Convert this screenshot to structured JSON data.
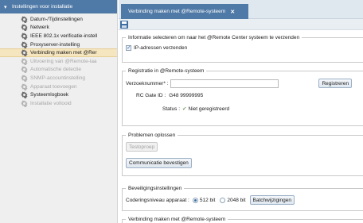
{
  "nav": {
    "header": "Instellingen voor installatie",
    "items": [
      {
        "label": "Datum-/Tijdinstellingen",
        "state": "normal"
      },
      {
        "label": "Netwerk",
        "state": "normal"
      },
      {
        "label": "IEEE 802.1x verificatie-instell",
        "state": "normal"
      },
      {
        "label": "Proxyserver-instelling",
        "state": "normal"
      },
      {
        "label": "Verbinding maken met @Rer",
        "state": "active"
      },
      {
        "label": "Uitvoering van @Remote-laa",
        "state": "disabled"
      },
      {
        "label": "Automatische detectie",
        "state": "disabled"
      },
      {
        "label": "SNMP-accountinstelling",
        "state": "disabled"
      },
      {
        "label": "Apparaat toevoegen",
        "state": "disabled"
      },
      {
        "label": "Systeemlogboek",
        "state": "normal"
      },
      {
        "label": "Installatie voltooid",
        "state": "disabled"
      }
    ]
  },
  "tab": {
    "title": "Verbinding maken met @Remote-systeem",
    "close": "✕"
  },
  "info": {
    "legend": "Informatie selecteren om naar het @Remote Center systeem te verzenden",
    "checkbox_label": "IP-adressen verzenden"
  },
  "registration": {
    "legend": "Registratie in @Remote-systeem",
    "request_label": "Verzoeknummer* :",
    "request_value": "",
    "register_button": "Registreren",
    "rc_label": "RC Gate ID :",
    "rc_value": "G48    99999995",
    "status_label": "Status :",
    "status_value": "Niet geregistreerd"
  },
  "troubleshoot": {
    "legend": "Problemen oplossen",
    "test_button": "Testoproep",
    "confirm_button": "Communicatie bevestigen"
  },
  "security": {
    "legend": "Beveiligingsinstellingen",
    "level_label": "Coderingsniveau apparaat :",
    "option1": "512 bit",
    "option2": "2048 bit",
    "changes_button": "Batchwijzigingen"
  },
  "next": {
    "legend": "Verbinding maken met @Remote-systeem"
  }
}
